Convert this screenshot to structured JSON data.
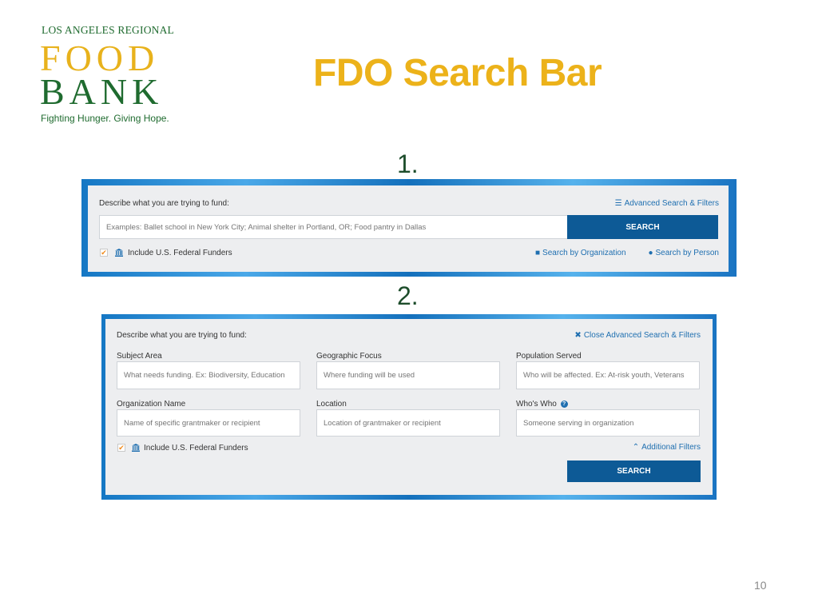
{
  "logo": {
    "top_line": "LOS ANGELES REGIONAL",
    "word1": "FOOD",
    "word2": "BANK",
    "tagline": "Fighting Hunger. Giving Hope."
  },
  "slide": {
    "title": "FDO Search Bar",
    "page_number": "10",
    "colors": {
      "title": "#ecb21a",
      "brand_green": "#1f6b2f",
      "button": "#0d5a96",
      "link": "#1f6fb0",
      "checkbox": "#f08a1c"
    }
  },
  "panel1": {
    "step_label": "1.",
    "describe_label": "Describe what you are trying to fund:",
    "advanced_link": "Advanced Search & Filters",
    "advanced_icon": "sliders-icon",
    "search_placeholder": "Examples: Ballet school in New York City; Animal shelter in Portland, OR; Food pantry in Dallas",
    "search_button": "SEARCH",
    "federal_checkbox_checked": true,
    "federal_label": "Include U.S. Federal Funders",
    "federal_icon": "bank-icon",
    "search_by_org": "Search by Organization",
    "search_by_org_icon": "briefcase-icon",
    "search_by_person": "Search by Person",
    "search_by_person_icon": "user-icon"
  },
  "panel2": {
    "step_label": "2.",
    "describe_label": "Describe what you are trying to fund:",
    "close_link": "Close Advanced Search & Filters",
    "close_icon": "close-icon",
    "fields": [
      {
        "label": "Subject Area",
        "placeholder": "What needs funding. Ex: Biodiversity, Education"
      },
      {
        "label": "Geographic Focus",
        "placeholder": "Where funding will be used"
      },
      {
        "label": "Population Served",
        "placeholder": "Who will be affected. Ex: At-risk youth, Veterans"
      },
      {
        "label": "Organization Name",
        "placeholder": "Name of specific grantmaker or recipient"
      },
      {
        "label": "Location",
        "placeholder": "Location of grantmaker or recipient"
      },
      {
        "label": "Who's Who",
        "placeholder": "Someone serving in organization",
        "help_icon": "question-circle-icon"
      }
    ],
    "federal_checkbox_checked": true,
    "federal_label": "Include U.S. Federal Funders",
    "additional_filters": "Additional Filters",
    "additional_filters_icon": "chevron-up-icon",
    "search_button": "SEARCH"
  }
}
